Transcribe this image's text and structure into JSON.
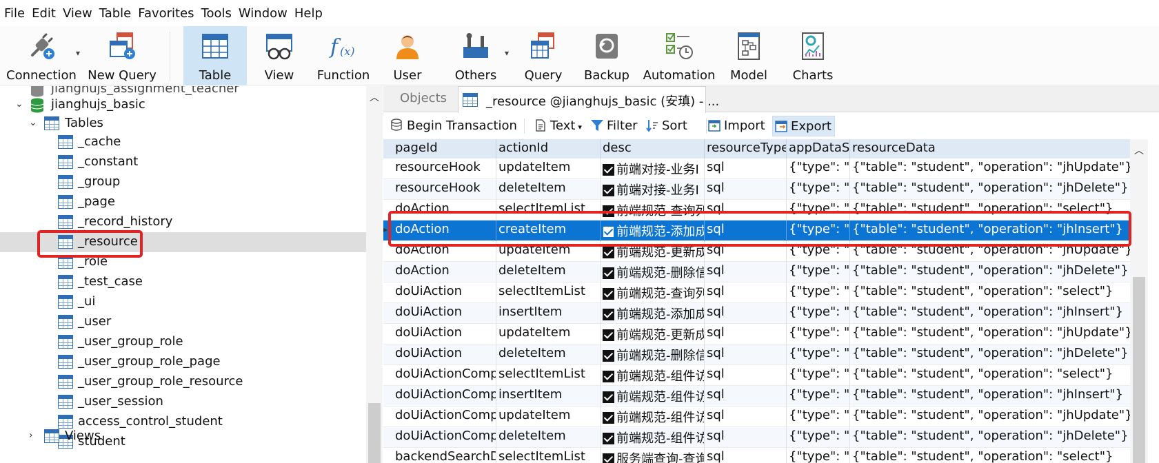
{
  "menu": [
    "File",
    "Edit",
    "View",
    "Table",
    "Favorites",
    "Tools",
    "Window",
    "Help"
  ],
  "toolbar": {
    "connection": "Connection",
    "new_query": "New Query",
    "table": "Table",
    "view": "View",
    "function": "Function",
    "user": "User",
    "others": "Others",
    "query": "Query",
    "backup": "Backup",
    "automation": "Automation",
    "model": "Model",
    "charts": "Charts"
  },
  "navigator": {
    "top_partial": "jianghujs_assignment_teacher",
    "database": "jianghujs_basic",
    "tables_label": "Tables",
    "tables": [
      "_cache",
      "_constant",
      "_group",
      "_page",
      "_record_history",
      "_resource",
      "_role",
      "_test_case",
      "_ui",
      "_user",
      "_user_group_role",
      "_user_group_role_page",
      "_user_group_role_resource",
      "_user_session",
      "access_control_student",
      "student"
    ],
    "selected_table": "_resource",
    "views_label": "Views"
  },
  "tabs": {
    "objects": "Objects",
    "resource_tab": "_resource @jianghujs_basic (安瑱) - ..."
  },
  "subtoolbar": {
    "begin_transaction": "Begin Transaction",
    "text": "Text",
    "filter": "Filter",
    "sort": "Sort",
    "import": "Import",
    "export": "Export"
  },
  "grid": {
    "columns": [
      "pageId",
      "actionId",
      "desc",
      "resourceType",
      "appDataSc",
      "resourceData"
    ],
    "rows": [
      {
        "pageId": "resourceHook",
        "actionId": "updateItem",
        "desc": "前端对接-业务I",
        "resourceType": "sql",
        "appDataSchema": "{\"type\": \"o",
        "resourceData": "{\"table\": \"student\", \"operation\": \"jhUpdate\"}"
      },
      {
        "pageId": "resourceHook",
        "actionId": "deleteItem",
        "desc": "前端对接-业务I",
        "resourceType": "sql",
        "appDataSchema": "{\"type\": \"o",
        "resourceData": "{\"table\": \"student\", \"operation\": \"jhDelete\"}"
      },
      {
        "pageId": "doAction",
        "actionId": "selectItemList",
        "desc": "前端规范-查询列",
        "resourceType": "sql",
        "appDataSchema": "{\"type\": \"o",
        "resourceData": "{\"table\": \"student\", \"operation\": \"select\"}"
      },
      {
        "pageId": "doAction",
        "actionId": "createItem",
        "desc": "前端规范-添加成",
        "resourceType": "sql",
        "appDataSchema": "{\"type\": \"o",
        "resourceData": "{\"table\": \"student\", \"operation\": \"jhInsert\"}"
      },
      {
        "pageId": "doAction",
        "actionId": "updateItem",
        "desc": "前端规范-更新成",
        "resourceType": "sql",
        "appDataSchema": "{\"type\": \"o",
        "resourceData": "{\"table\": \"student\", \"operation\": \"jhUpdate\"}"
      },
      {
        "pageId": "doAction",
        "actionId": "deleteItem",
        "desc": "前端规范-删除信",
        "resourceType": "sql",
        "appDataSchema": "{\"type\": \"o",
        "resourceData": "{\"table\": \"student\", \"operation\": \"jhDelete\"}"
      },
      {
        "pageId": "doUiAction",
        "actionId": "selectItemList",
        "desc": "前端规范-查询列",
        "resourceType": "sql",
        "appDataSchema": "{\"type\": \"o",
        "resourceData": "{\"table\": \"student\", \"operation\": \"select\"}"
      },
      {
        "pageId": "doUiAction",
        "actionId": "insertItem",
        "desc": "前端规范-添加成",
        "resourceType": "sql",
        "appDataSchema": "{\"type\": \"o",
        "resourceData": "{\"table\": \"student\", \"operation\": \"jhInsert\"}"
      },
      {
        "pageId": "doUiAction",
        "actionId": "updateItem",
        "desc": "前端规范-更新成",
        "resourceType": "sql",
        "appDataSchema": "{\"type\": \"o",
        "resourceData": "{\"table\": \"student\", \"operation\": \"jhUpdate\"}"
      },
      {
        "pageId": "doUiAction",
        "actionId": "deleteItem",
        "desc": "前端规范-删除信",
        "resourceType": "sql",
        "appDataSchema": "{\"type\": \"o",
        "resourceData": "{\"table\": \"student\", \"operation\": \"jhDelete\"}"
      },
      {
        "pageId": "doUiActionComp",
        "actionId": "selectItemList",
        "desc": "前端规范-组件访",
        "resourceType": "sql",
        "appDataSchema": "{\"type\": \"o",
        "resourceData": "{\"table\": \"student\", \"operation\": \"select\"}"
      },
      {
        "pageId": "doUiActionComp",
        "actionId": "insertItem",
        "desc": "前端规范-组件访",
        "resourceType": "sql",
        "appDataSchema": "{\"type\": \"o",
        "resourceData": "{\"table\": \"student\", \"operation\": \"jhInsert\"}"
      },
      {
        "pageId": "doUiActionComp",
        "actionId": "updateItem",
        "desc": "前端规范-组件访",
        "resourceType": "sql",
        "appDataSchema": "{\"type\": \"o",
        "resourceData": "{\"table\": \"student\", \"operation\": \"jhUpdate\"}"
      },
      {
        "pageId": "doUiActionComp",
        "actionId": "deleteItem",
        "desc": "前端规范-组件访",
        "resourceType": "sql",
        "appDataSchema": "{\"type\": \"o",
        "resourceData": "{\"table\": \"student\", \"operation\": \"jhDelete\"}"
      },
      {
        "pageId": "backendSearchD",
        "actionId": "selectItemList",
        "desc": "服务端查询-查询",
        "resourceType": "sql",
        "appDataSchema": "{\"type\": \"o",
        "resourceData": "{\"table\": \"student\", \"operation\": \"select\"}"
      }
    ],
    "selected_row_index": 3
  },
  "colors": {
    "selection": "#0c74d2",
    "highlight_box": "#e02424",
    "toolbar_active": "#cfe4f5",
    "header_bg": "#dfe9f5"
  }
}
